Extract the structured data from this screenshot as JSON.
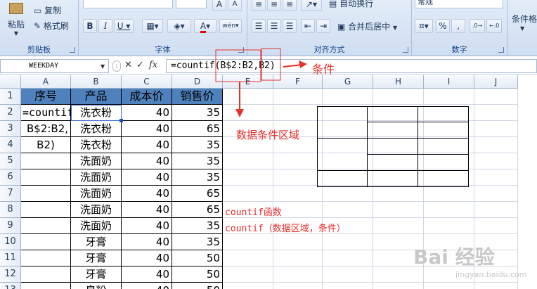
{
  "ribbon": {
    "paste_label": "粘贴",
    "copy_label": "复制",
    "format_painter_label": "格式刷",
    "wrap_text_label": "自动换行",
    "merge_center_label": "合并后居中",
    "number_format": "常规",
    "percent_symbol": "%",
    "comma_symbol": ",",
    "cond_format_label": "条件格式",
    "groups": {
      "clipboard": "剪贴板",
      "font": "字体",
      "alignment": "对齐方式",
      "number": "数字"
    }
  },
  "formula_bar": {
    "name_box": "WEEKDAY",
    "formula_text": "=countif(B$2:B2,B2)"
  },
  "annotations": {
    "condition": "条件",
    "data_region": "数据条件区域",
    "note1": "countif函数",
    "note2": "countif（数据区域，条件）"
  },
  "columns": [
    "A",
    "B",
    "C",
    "D",
    "E",
    "F",
    "G",
    "H",
    "I",
    "J"
  ],
  "rows": [
    "1",
    "2",
    "3",
    "4",
    "5",
    "6",
    "7",
    "8",
    "9",
    "10",
    "11",
    "12",
    "13"
  ],
  "table": {
    "headers": [
      "序号",
      "产品",
      "成本价",
      "销售价"
    ],
    "a_edit_lines": [
      "=countif(",
      "B$2:B2,",
      "B2)"
    ],
    "data": [
      [
        "洗衣粉",
        "40",
        "35"
      ],
      [
        "洗衣粉",
        "40",
        "65"
      ],
      [
        "洗衣粉",
        "40",
        "35"
      ],
      [
        "洗面奶",
        "40",
        "35"
      ],
      [
        "洗面奶",
        "40",
        "35"
      ],
      [
        "洗面奶",
        "40",
        "65"
      ],
      [
        "洗面奶",
        "40",
        "65"
      ],
      [
        "洗面奶",
        "40",
        "35"
      ],
      [
        "牙膏",
        "40",
        "35"
      ],
      [
        "牙膏",
        "40",
        "50"
      ],
      [
        "牙膏",
        "40",
        "50"
      ],
      [
        "皂粉",
        "40",
        "50"
      ]
    ]
  },
  "watermark": {
    "brand": "Bai 经验",
    "url": "jingyan.baidu.com"
  },
  "colors": {
    "header_fill": "#4f81bd",
    "annotation_red": "#e8302a"
  }
}
